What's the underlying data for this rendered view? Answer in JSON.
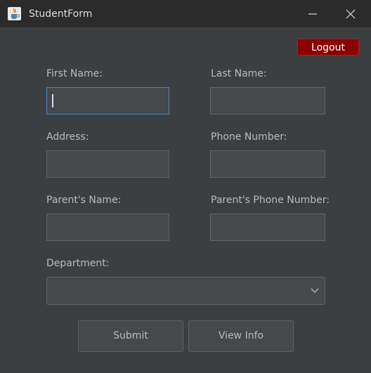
{
  "window": {
    "title": "StudentForm",
    "icon": "java-cup-icon"
  },
  "header": {
    "logout_label": "Logout"
  },
  "form": {
    "first_name_label": "First Name:",
    "first_name_value": "",
    "last_name_label": "Last Name:",
    "last_name_value": "",
    "address_label": "Address:",
    "address_value": "",
    "phone_label": "Phone Number:",
    "phone_value": "",
    "parent_name_label": "Parent's Name:",
    "parent_name_value": "",
    "parent_phone_label": "Parent's Phone Number:",
    "parent_phone_value": "",
    "department_label": "Department:",
    "department_selected": ""
  },
  "actions": {
    "submit_label": "Submit",
    "view_info_label": "View Info"
  },
  "colors": {
    "background": "#3c3f41",
    "titlebar": "#2b2b2b",
    "logout": "#8b0000",
    "focus_border": "#4a88c7"
  }
}
